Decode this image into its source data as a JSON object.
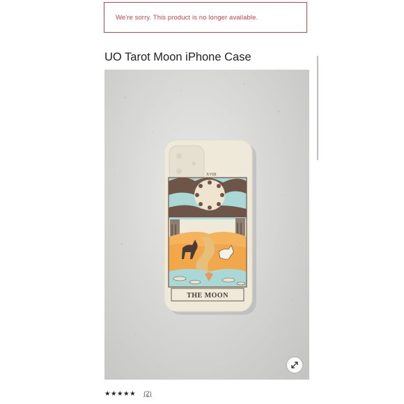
{
  "alert": {
    "message": "We're sorry. This product is no longer available.",
    "color": "#c9414b"
  },
  "product": {
    "title": "UO Tarot Moon iPhone Case",
    "image": {
      "subject": "iPhone case with tarot card print",
      "card_number": "XVIII",
      "card_title": "THE MOON"
    },
    "expand_icon": "expand-arrows-icon"
  },
  "rating": {
    "stars_display": "★★★★★",
    "rating_value": 4.5,
    "rating_max": 5,
    "review_count": "(2)"
  }
}
